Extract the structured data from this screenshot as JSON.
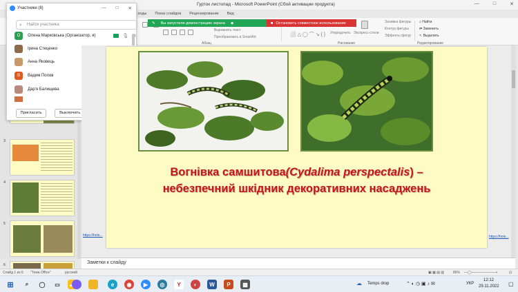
{
  "window": {
    "title": "Гурток листопад - Microsoft PowerPoint (Сбой активации продукта)",
    "controls": [
      "—",
      "□",
      "✕"
    ]
  },
  "menu_tabs": [
    "Рецензирование",
    "Вид"
  ],
  "menu_tabs_partial": [
    "...ходы",
    "Показ слайдов"
  ],
  "ribbon": {
    "groups": [
      "Абзац",
      "Рисование",
      "Редактирование"
    ],
    "labels": {
      "direction": "Направление текста",
      "align": "Выровнять текст",
      "smartart": "Преобразовать в SmartArt",
      "arrange": "Упорядочить",
      "styles": "Экспресс-стили",
      "fill": "Заливка фигуры",
      "outline": "Контур фигуры",
      "effects": "Эффекты фигур",
      "find": "Найти",
      "replace": "Заменить",
      "select": "Выделить"
    }
  },
  "share_banner": {
    "green_text": "Вы запустили демонстрацию экрана",
    "red_text": "Остановить совместное использование",
    "colors": {
      "green": "#23a556",
      "red": "#d93434"
    }
  },
  "participants": {
    "title": "Участники (8)",
    "search_placeholder": "Найти участника",
    "people": [
      {
        "name": "Олена Марковська (Організатор, я)",
        "initial": "О",
        "color": "#2e9e4f",
        "video": true,
        "muted": false
      },
      {
        "name": "Ірина Стеценко",
        "initial": "",
        "color": "#8b6b4a",
        "video": false,
        "muted": false
      },
      {
        "name": "Анна Яковець",
        "initial": "",
        "color": "#c89a6a",
        "video": false,
        "muted": true
      },
      {
        "name": "Вадим Попов",
        "initial": "В",
        "color": "#e05a1e",
        "video": false,
        "muted": true
      },
      {
        "name": "Дар'я Балищева",
        "initial": "",
        "color": "#b88a7a",
        "video": false,
        "muted": true
      }
    ],
    "buttons": {
      "invite": "Пригласить",
      "mute_all": "Выключить звук для всех",
      "more": "···"
    }
  },
  "thumbnails": {
    "numbers": [
      "3",
      "4",
      "5",
      "6"
    ]
  },
  "slide": {
    "title_main": "Вогнівка самшитова",
    "title_latin": "(Cydalima perspectalis",
    "title_end": ") –",
    "title_line2": "небезпечний шкідник декоративних насаджень",
    "link_left": "https://holo...",
    "link_right": "https://holo..."
  },
  "notes": {
    "placeholder": "Заметки к слайду"
  },
  "status": {
    "slide": "Слайд 1 из 6",
    "theme": "\"Тема Office\"",
    "lang": "русский",
    "zoom": "86%"
  },
  "taskbar": {
    "weather": "Temps drop",
    "lang": "УКР",
    "time": "12:12",
    "date": "29.11.2022"
  }
}
